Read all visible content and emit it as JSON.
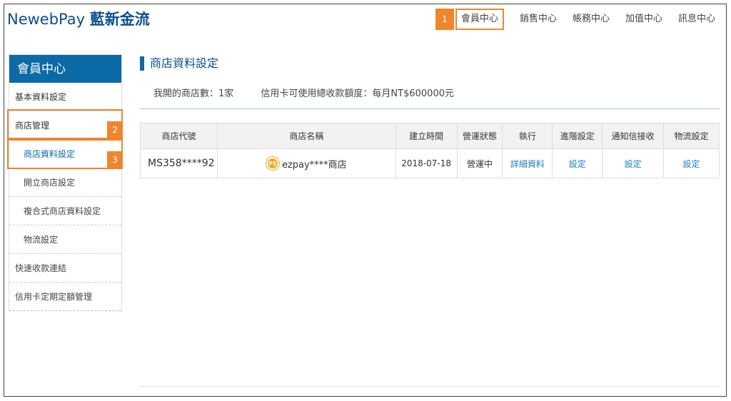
{
  "brand": {
    "name_en": "NewebPay",
    "name_cn": "藍新金流"
  },
  "topnav": {
    "badge": "1",
    "items": [
      "會員中心",
      "銷售中心",
      "帳務中心",
      "加值中心",
      "訊息中心"
    ]
  },
  "sidebar": {
    "title": "會員中心",
    "items": [
      "基本資料設定",
      "商店管理",
      "商店資料設定",
      "開立商店設定",
      "複合式商店資料設定",
      "物流設定",
      "快速收款連結",
      "信用卡定期定額管理"
    ],
    "badge2": "2",
    "badge3": "3"
  },
  "page": {
    "title": "商店資料設定",
    "store_count": "我開的商店數：1家",
    "card_limit": "信用卡可使用總收款額度：每月NT$600000元"
  },
  "table": {
    "headers": [
      "商店代號",
      "商店名稱",
      "建立時間",
      "營運狀態",
      "執行",
      "進階設定",
      "通知信接收",
      "物流設定"
    ],
    "row": {
      "code": "MS358****92",
      "icon_text": "PS",
      "name": "ezpay****商店",
      "created": "2018-07-18",
      "status": "營運中",
      "action": "詳細資料",
      "advanced": "設定",
      "notify": "設定",
      "logistics": "設定"
    }
  },
  "colors": {
    "accent": "#f0852d",
    "primary": "#0c6aa6",
    "link": "#1a80c8"
  }
}
